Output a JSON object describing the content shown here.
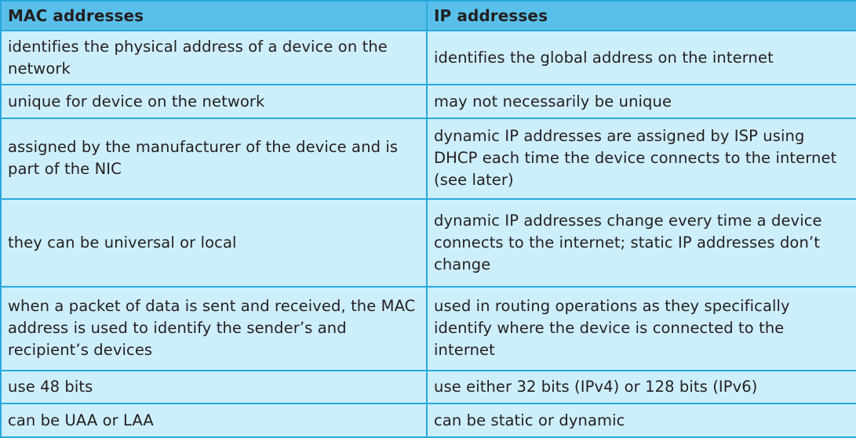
{
  "table": {
    "headers": [
      "MAC addresses",
      "IP addresses"
    ],
    "rows": [
      [
        "identifies the physical address of a device on the network",
        "identifies the global address on the internet"
      ],
      [
        "unique for device on the network",
        "may not necessarily be unique"
      ],
      [
        "assigned by the manufacturer of the device and is part of the NIC",
        "dynamic IP addresses are assigned by ISP using DHCP each time the device connects to the internet (see later)"
      ],
      [
        "they can be universal or local",
        "dynamic IP addresses change every time a device connects to the internet; static IP addresses don’t change"
      ],
      [
        "when a packet of data is sent and received, the MAC address is used to identify the sender’s and recipient’s devices",
        "used in routing operations as they specifically identify where the device is connected to the internet"
      ],
      [
        "use 48 bits",
        "use either 32 bits (IPv4) or 128 bits (IPv6)"
      ],
      [
        "can be UAA or LAA",
        "can be static or dynamic"
      ]
    ]
  },
  "colors": {
    "header_bg": "#58c0ea",
    "cell_bg": "#cdeefb",
    "border": "#29a9e0"
  }
}
